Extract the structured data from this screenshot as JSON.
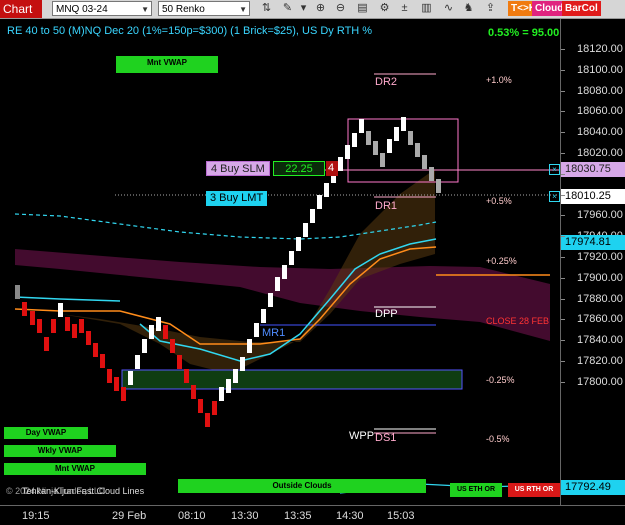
{
  "toolbar": {
    "title": "Chart",
    "instrument": "MNQ 03-24",
    "bartype": "50 Renko",
    "tools": [
      "cursor-icon",
      "pencil-icon",
      "drawing-tools-icon",
      "zoom-in-icon",
      "zoom-out-icon",
      "bars-icon",
      "property-icon",
      "plus-minus-icon",
      "layout-icon",
      "indicator-icon",
      "strategy-icon",
      "share-icon"
    ],
    "btn_tk": "T<>K",
    "btn_cloud": "Cloud",
    "btn_barcol": "BarCol"
  },
  "header": {
    "text": "RE 40 to 50 (M)NQ Dec 20 (1%=150p=$300) (1 Brick=$25), US Dy RTH %",
    "pct": "0.53% = 95.00"
  },
  "buttons": {
    "mnt_vwap_top": "Mnt VWAP",
    "day_vwap": "Day VWAP",
    "wkly_vwap": "Wkly VWAP",
    "mnt_vwap": "Mnt VWAP",
    "outside_clouds": "Outside Clouds",
    "us_eth_or": "US ETH OR",
    "us_rth_or": "US RTH OR"
  },
  "footer_text": "© 2024 NinjaTrader, LLC",
  "tenkan_text": "Tenkan-Kijun Fast Cloud Lines",
  "orders": {
    "buy_slm": "4 Buy SLM",
    "buy_slm_price": "22.25",
    "buy_slm_qty": "4",
    "buy_lmt": "3 Buy LMT"
  },
  "levels": {
    "dr2": "DR2",
    "dr1": "DR1",
    "dpp": "DPP",
    "mr1": "MR1",
    "wpp": "WPP",
    "ds1": "DS1",
    "p1": "+1.0%",
    "p05": "+0.5%",
    "p025": "+0.25%",
    "m025": "-0.25%",
    "m05": "-0.5%",
    "close": "CLOSE 28 FEB"
  },
  "y_axis": [
    "18120.00",
    "18100.00",
    "18080.00",
    "18060.00",
    "18040.00",
    "18020.00",
    "18000.00",
    "17980.00",
    "17960.00",
    "17940.00",
    "17920.00",
    "17900.00",
    "17880.00",
    "17860.00",
    "17840.00",
    "17820.00",
    "17800.00"
  ],
  "price_tags": {
    "buy_slm": "18030.75",
    "buy_lmt": "18010.25",
    "last": "17974.81",
    "lower": "17792.49"
  },
  "x_axis": [
    "19:15",
    "29 Feb",
    "08:10",
    "13:30",
    "13:35",
    "14:30",
    "15:03"
  ],
  "colors": {
    "up_brick": "#ffffff",
    "down_brick": "#e01010",
    "cloud_purple": "#5a0f3a",
    "green_zone": "#0f3d12",
    "accent_green": "#1fd21f",
    "cyan": "#31d7f0",
    "orange": "#ff8c1a"
  }
}
